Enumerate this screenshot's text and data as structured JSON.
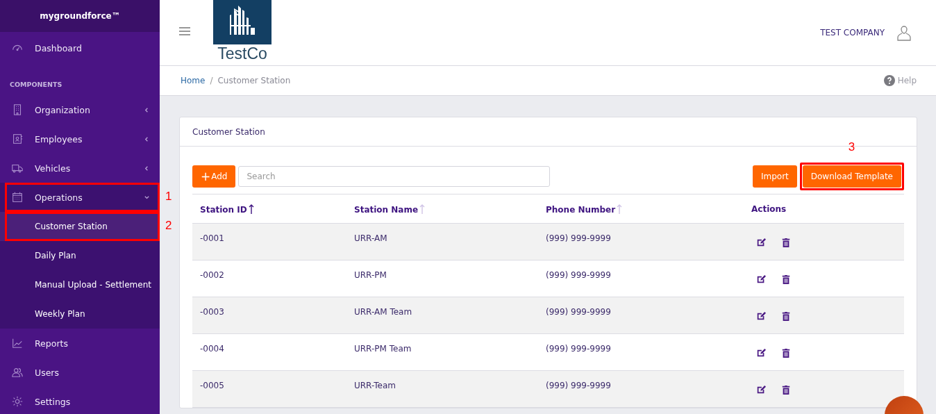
{
  "sidebar": {
    "brand": "mygroundforce™",
    "items": [
      {
        "kind": "link",
        "label": "Dashboard",
        "selected": false
      },
      {
        "kind": "heading",
        "label": "COMPONENTS"
      },
      {
        "kind": "link",
        "label": "Organization",
        "selected": false,
        "expanded": false
      },
      {
        "kind": "link",
        "label": "Employees",
        "selected": false,
        "expanded": false
      },
      {
        "kind": "link",
        "label": "Vehicles",
        "selected": false,
        "expanded": false
      },
      {
        "kind": "link",
        "label": "Operations",
        "selected": true,
        "expanded": true,
        "annotation": "1",
        "children": [
          {
            "label": "Customer Station",
            "selected": true,
            "annotation": "2"
          },
          {
            "label": "Daily Plan",
            "selected": false
          },
          {
            "label": "Manual Upload - Settlement",
            "selected": false
          },
          {
            "label": "Weekly Plan",
            "selected": false
          }
        ]
      },
      {
        "kind": "link",
        "label": "Reports",
        "selected": false
      },
      {
        "kind": "link",
        "label": "Users",
        "selected": false
      },
      {
        "kind": "link",
        "label": "Settings",
        "selected": false
      }
    ]
  },
  "header": {
    "logo_text": "TestCo",
    "company": "TEST COMPANY"
  },
  "breadcrumb": [
    "Home",
    "Customer Station"
  ],
  "breadcrumb_separator": "/",
  "help": "Help",
  "card": {
    "title": "Customer Station",
    "add_button": {
      "icon": "+",
      "label": "Add"
    },
    "search": {
      "placeholder": "Search"
    },
    "buttons": [
      {
        "label": "Import"
      },
      {
        "label": "Download Template",
        "annotation": "3"
      }
    ],
    "table": {
      "columns": [
        {
          "label": "Station ID",
          "sorted": true
        },
        {
          "label": "Station Name",
          "sorted": false
        },
        {
          "label": "Phone Number",
          "sorted": false
        },
        {
          "label": "Actions"
        }
      ],
      "rows": [
        {
          "id": "-0001",
          "name": "URR-AM",
          "phone": "(999) 999-9999"
        },
        {
          "id": "-0002",
          "name": "URR-PM",
          "phone": "(999) 999-9999"
        },
        {
          "id": "-0003",
          "name": "URR-AM Team",
          "phone": "(999) 999-9999"
        },
        {
          "id": "-0004",
          "name": "URR-PM Team",
          "phone": "(999) 999-9999"
        },
        {
          "id": "-0005",
          "name": "URR-Team",
          "phone": "(999) 999-9999"
        }
      ]
    }
  }
}
